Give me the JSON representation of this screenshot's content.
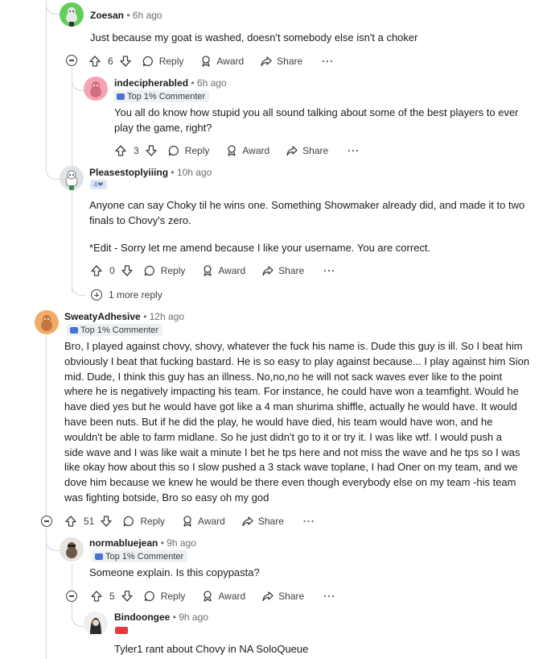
{
  "comments": [
    {
      "username": "Zoesan",
      "time": "6h ago",
      "body": [
        "Just because my goat is washed, doesn't somebody else isn't a choker"
      ],
      "votes": "6"
    },
    {
      "username": "indecipherabled",
      "time": "6h ago",
      "badge": "Top 1% Commenter",
      "body": [
        "You all do know how stupid you all sound talking about some of the best players to ever",
        "play the game, right?"
      ],
      "votes": "3"
    },
    {
      "username": "Pleasestoplyiiing",
      "time": "10h ago",
      "flair": "4❤",
      "body": [
        "Anyone can say Choky til he wins one. Something Showmaker already did, and made it to two",
        "finals to Chovy's zero.",
        "",
        "*Edit - Sorry let me amend because I like your username. You are correct."
      ],
      "votes": "0"
    },
    {
      "username": "SweatyAdhesive",
      "time": "12h ago",
      "badge": "Top 1% Commenter",
      "body": [
        "Bro, I played against chovy, shovy, whatever the fuck his name is. Dude this guy is ill. So I beat him",
        "obviously I beat that fucking bastard. He is so easy to play against because... I play against him Sion",
        "mid. Dude, I think this guy has an illness. No,no,no he will not sack waves ever like to the point",
        "where he is negatively impacting his team. For instance, he could have won a teamfight. Would he",
        "have died yes but he would have got like a 4 man shurima shiffle, actually he would have. It would",
        "have been nuts. But if he did the play, he would have died, his team would have won, and he",
        "wouldn't be able to farm midlane. So he just didn't go to it or try it. I was like wtf. I would push a",
        "side wave and I was like wait a minute I bet he tps here and not miss the wave and he tps so I was",
        "like okay how about this so I slow pushed a 3 stack wave toplane, I had Oner on my team, and we",
        "dove him because we knew he would be there even though everybody else on my team -his team",
        "was fighting botside, Bro so easy oh my god"
      ],
      "votes": "51"
    },
    {
      "username": "normabluejean",
      "time": "9h ago",
      "badge": "Top 1% Commenter",
      "body": [
        "Someone explain. Is this copypasta?"
      ],
      "votes": "5"
    },
    {
      "username": "Bindoongee",
      "time": "9h ago",
      "body": [
        "Tyler1 rant about Chovy in NA SoloQueue"
      ]
    }
  ],
  "labels": {
    "reply": "Reply",
    "award": "Award",
    "share": "Share",
    "more": "···",
    "dot": "•",
    "more_replies": "1 more reply"
  },
  "colors": {
    "text": "#1c1c1c",
    "meta": "#6a6f73",
    "line": "#d3d6d9",
    "badge_bg": "#eef1f3"
  },
  "icons": [
    "upvote-icon",
    "downvote-icon",
    "reply-icon",
    "award-icon",
    "share-icon",
    "more-icon",
    "collapse-icon",
    "expand-icon"
  ]
}
